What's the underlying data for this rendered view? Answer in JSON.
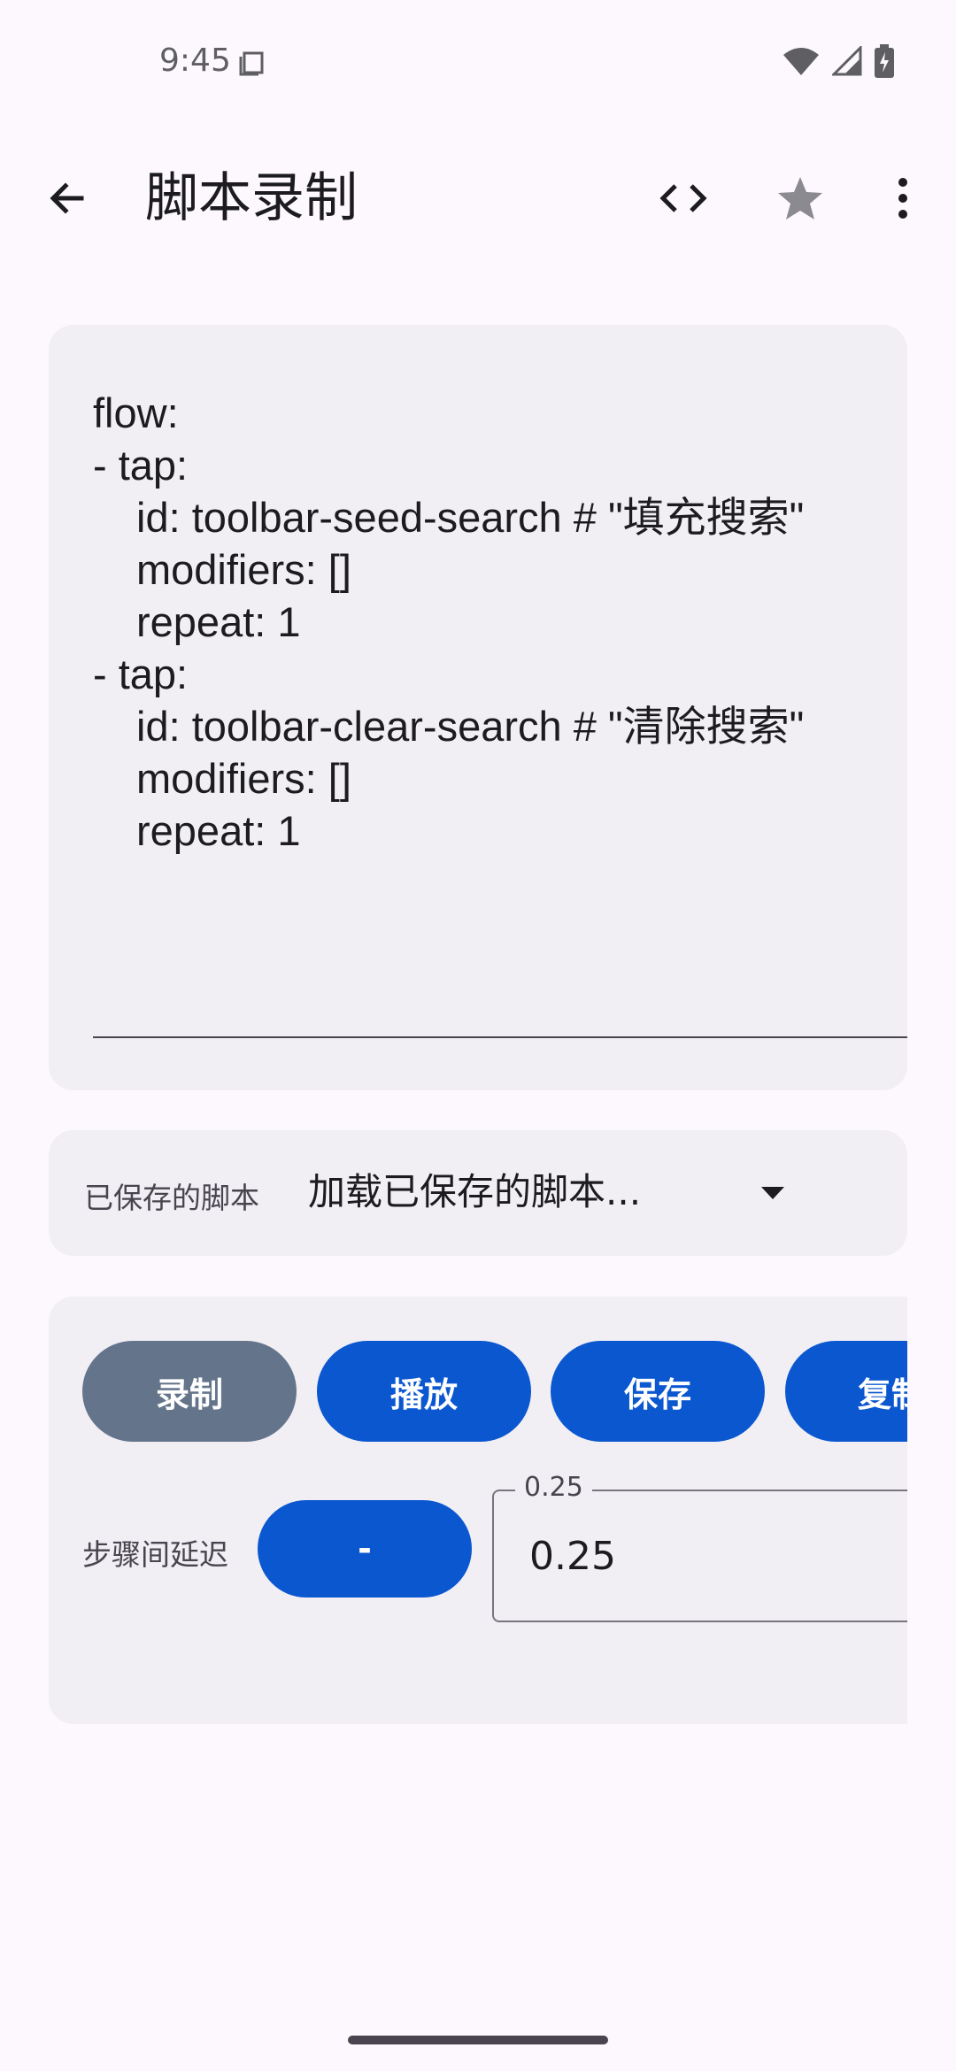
{
  "status_bar": {
    "time": "9:45",
    "icons": [
      "notification-icon",
      "wifi-icon",
      "signal-icon",
      "battery-charging-icon"
    ]
  },
  "app_bar": {
    "title": "脚本录制",
    "back_icon": "arrow-back-icon",
    "actions": [
      "code-icon",
      "star-icon",
      "more-vert-icon"
    ]
  },
  "editor": {
    "lines": [
      {
        "text": "flow:",
        "indent": false
      },
      {
        "text": "- tap:",
        "indent": false
      },
      {
        "text": "id: toolbar-seed-search # \"填充搜索\"",
        "indent": true
      },
      {
        "text": "modifiers: []",
        "indent": true
      },
      {
        "text": "repeat: 1",
        "indent": true
      },
      {
        "text": "- tap:",
        "indent": false
      },
      {
        "text": "id: toolbar-clear-search # \"清除搜索\"",
        "indent": true
      },
      {
        "text": "modifiers: []",
        "indent": true
      },
      {
        "text": "repeat: 1",
        "indent": true
      }
    ]
  },
  "saved_scripts": {
    "label": "已保存的脚本",
    "selected": "加载已保存的脚本..."
  },
  "controls": {
    "record_label": "录制",
    "play_label": "播放",
    "save_label": "保存",
    "copy_label": "复制",
    "delay_label": "步骤间延迟",
    "minus_label": "-",
    "delay_field_legend": "0.25",
    "delay_field_value": "0.25"
  },
  "colors": {
    "primary": "#0b57d0",
    "record": "#64748b",
    "card": "#f1eff4",
    "background": "#fdf8fd"
  }
}
